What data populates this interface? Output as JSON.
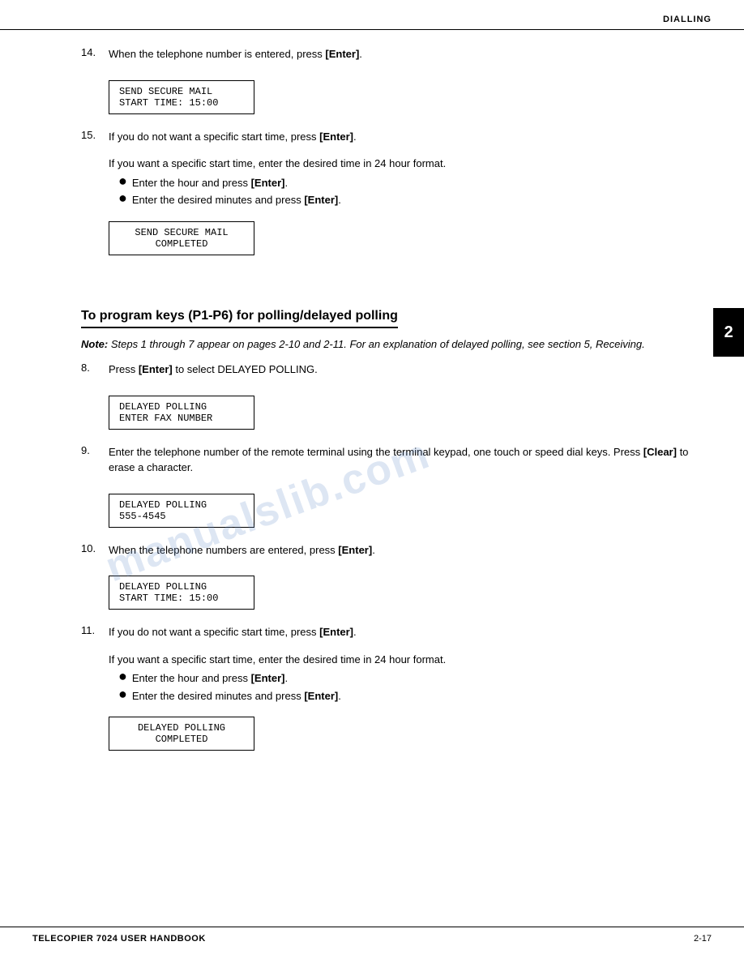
{
  "header": {
    "title": "DIALLING"
  },
  "side_tab": {
    "label": "2"
  },
  "watermark": "manualslib.com",
  "footer": {
    "left": "TELECOPIER 7024 USER HANDBOOK",
    "right": "2-17"
  },
  "steps_group1": [
    {
      "number": "14.",
      "text": "When the telephone number is entered, press [Enter].",
      "lcd": {
        "line1": "SEND SECURE MAIL",
        "line2": "START TIME:    15:00",
        "center": false
      }
    },
    {
      "number": "15.",
      "text": "If you do not want a specific start time, press [Enter].",
      "sub_text": "If you want a specific start time, enter the desired time in 24 hour format.",
      "bullets": [
        "Enter the hour and press [Enter].",
        "Enter the desired minutes and press [Enter]."
      ],
      "lcd": {
        "line1": "SEND SECURE MAIL",
        "line2": "     COMPLETED",
        "center": true
      }
    }
  ],
  "section_heading": "To program keys (P1-P6) for polling/delayed polling",
  "note": "Note:  Steps 1 through 7 appear on pages 2-10 and 2-11.  For an explanation of delayed polling, see section 5, Receiving.",
  "steps_group2": [
    {
      "number": "8.",
      "text": "Press [Enter] to select DELAYED POLLING.",
      "lcd": {
        "line1": "DELAYED POLLING",
        "line2": "ENTER FAX NUMBER",
        "center": false
      }
    },
    {
      "number": "9.",
      "text": "Enter the telephone number of the remote terminal using the terminal keypad, one touch or speed dial keys.  Press [Clear] to erase a character.",
      "lcd": {
        "line1": "DELAYED POLLING",
        "line2": "555-4545",
        "center": false
      }
    },
    {
      "number": "10.",
      "text": "When the telephone numbers are entered, press [Enter].",
      "lcd": {
        "line1": "DELAYED POLLING",
        "line2": "START TIME:    15:00",
        "center": false
      }
    },
    {
      "number": "11.",
      "text": "If you do not want a specific start time, press [Enter].",
      "sub_text": "If you want a specific start time, enter the desired time in 24 hour format.",
      "bullets": [
        "Enter the hour and press [Enter].",
        "Enter the desired minutes and press [Enter]."
      ],
      "lcd": {
        "line1": "DELAYED POLLING",
        "line2": "     COMPLETED",
        "center": true
      }
    }
  ],
  "labels": {
    "bullet_dot": "●"
  }
}
